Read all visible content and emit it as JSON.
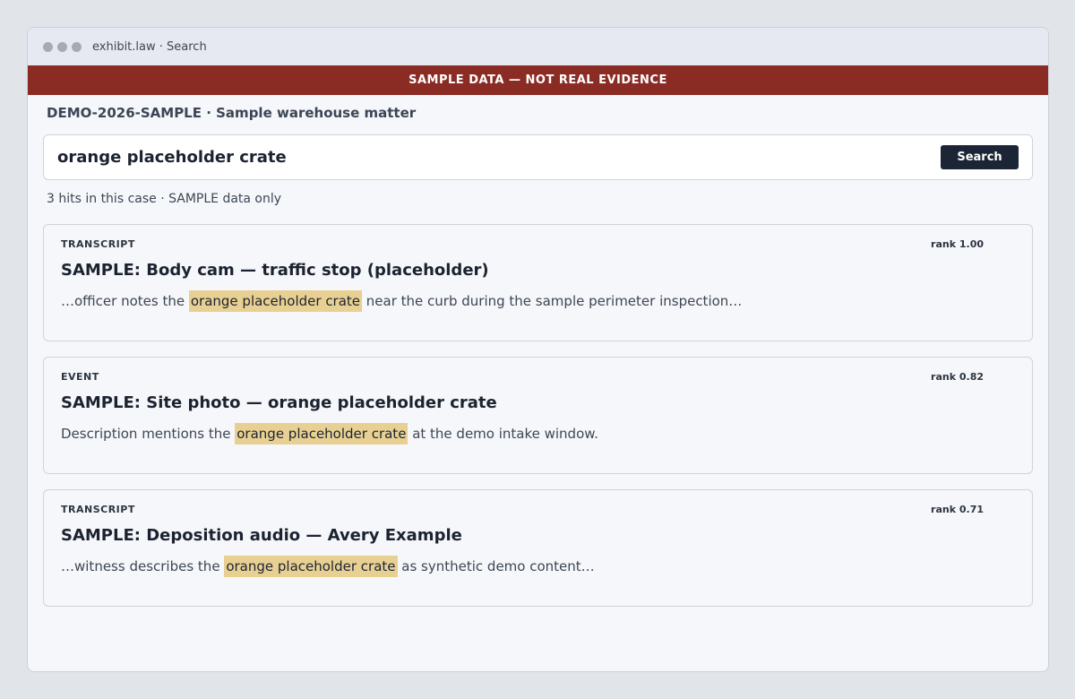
{
  "window": {
    "title": "exhibit.law · Search"
  },
  "banner": {
    "text": "SAMPLE DATA — NOT REAL EVIDENCE"
  },
  "case": {
    "title": "DEMO-2026-SAMPLE · Sample warehouse matter"
  },
  "search": {
    "query": "orange placeholder crate",
    "button_label": "Search"
  },
  "summary": {
    "text": "3 hits in this case · SAMPLE data only"
  },
  "results": [
    {
      "type": "TRANSCRIPT",
      "rank": "rank 1.00",
      "title": "SAMPLE: Body cam — traffic stop (placeholder)",
      "snippet_before": "…officer notes the ",
      "snippet_match": "orange placeholder crate",
      "snippet_after": " near the curb during the sample perimeter inspection…"
    },
    {
      "type": "EVENT",
      "rank": "rank 0.82",
      "title": "SAMPLE: Site photo — orange placeholder crate",
      "snippet_before": "Description mentions the ",
      "snippet_match": "orange placeholder crate",
      "snippet_after": " at the demo intake window."
    },
    {
      "type": "TRANSCRIPT",
      "rank": "rank 0.71",
      "title": "SAMPLE: Deposition audio — Avery Example",
      "snippet_before": "…witness describes the ",
      "snippet_match": "orange placeholder crate",
      "snippet_after": " as synthetic demo content…"
    }
  ],
  "colors": {
    "banner": "#8b2c24",
    "button": "#1b2535",
    "highlight": "#e8d093"
  }
}
